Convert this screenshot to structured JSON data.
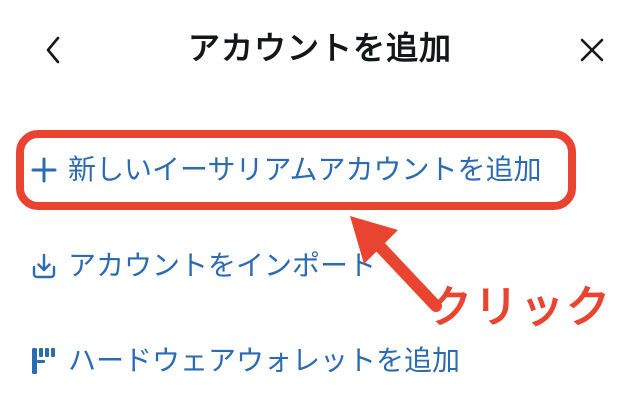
{
  "header": {
    "title": "アカウントを追加",
    "back_icon": "chevron-left-icon",
    "close_icon": "close-icon"
  },
  "menu": {
    "items": [
      {
        "icon": "plus-icon",
        "label": "新しいイーサリアムアカウントを追加"
      },
      {
        "icon": "download-icon",
        "label": "アカウントをインポート"
      },
      {
        "icon": "hardware-wallet-icon",
        "label": "ハードウェアウォレットを追加"
      }
    ]
  },
  "annotation": {
    "text": "クリック",
    "color": "#e8442f"
  },
  "colors": {
    "accent": "#2a6bb4",
    "title": "#141618",
    "highlight": "#e8442f"
  }
}
